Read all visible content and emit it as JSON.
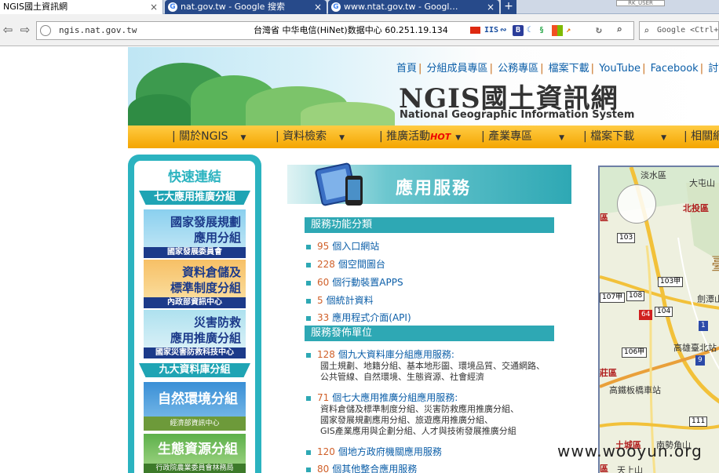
{
  "browser": {
    "tabs": [
      {
        "title": "NGIS國土資訊網",
        "close": "×"
      },
      {
        "title": "nat.gov.tw - Google 搜索",
        "close": "×"
      },
      {
        "title": "www.ntat.gov.tw - Googl…",
        "close": "×"
      }
    ],
    "new_tab": "+",
    "top_right_box": "RK_USER",
    "url": "ngis.nat.gov.tw",
    "isp_info": "台灣省 中华电信(HiNet)数据中心  60.251.19.134",
    "ext_iis": "IIS",
    "ext_b": "B",
    "search_placeholder": "Google <Ctrl+K>"
  },
  "header": {
    "toplinks": [
      "首頁",
      "分組成員專區",
      "公務專區",
      "檔案下載",
      "YouTube",
      "Facebook",
      "討論區"
    ],
    "logo_main": "NGIS國土資訊網",
    "logo_sub": "National Geographic Information System"
  },
  "menu": {
    "items": [
      "關於NGIS",
      "資料檢索",
      "推廣活動",
      "產業專區",
      "檔案下載",
      "相關網"
    ],
    "hot": "HOT"
  },
  "sidebar": {
    "title": "快速連結",
    "group1": "七大應用推廣分組",
    "banners1": [
      {
        "title1": "國家發展規劃",
        "title2": "應用分組",
        "unit": "國家發展委員會"
      },
      {
        "title1": "資料倉儲及",
        "title2": "標準制度分組",
        "unit": "內政部資訊中心"
      },
      {
        "title1": "災害防救",
        "title2": "應用推廣分組",
        "unit": "國家災害防救科技中心"
      }
    ],
    "group2": "九大資料庫分組",
    "banners2": [
      {
        "title": "自然環境分組",
        "unit": "經濟部資訊中心"
      },
      {
        "title": "生態資源分組",
        "unit": "行政院農業委員會林務局"
      }
    ]
  },
  "app_service": {
    "title": "應用服務",
    "section1": "服務功能分類",
    "items1": [
      {
        "num": "95",
        "label": "個入口網站"
      },
      {
        "num": "228",
        "label": "個空間圖台"
      },
      {
        "num": "60",
        "label": "個行動裝置APPS"
      },
      {
        "num": "5",
        "label": "個統計資料"
      },
      {
        "num": "33",
        "label": "應用程式介面(API)"
      }
    ],
    "section2": "服務發佈單位",
    "items2": [
      {
        "num": "128",
        "label": "個九大資料庫分組應用服務:",
        "desc": [
          "國土規劃、地籍分組、基本地形圖、環境品質、交通網路、",
          "公共管線、自然環境、生態資源、社會經濟"
        ]
      },
      {
        "num": "71",
        "label": "個七大應用推廣分組應用服務:",
        "desc": [
          "資料倉儲及標準制度分組、災害防救應用推廣分組、",
          "國家發展規劃應用分組、旅遊應用推廣分組、",
          "GIS產業應用與企劃分組、人才與技術發展推廣分組"
        ]
      },
      {
        "num": "120",
        "label": "個地方政府機關應用服務",
        "desc": []
      },
      {
        "num": "80",
        "label": "個其他整合應用服務",
        "desc": []
      }
    ]
  },
  "map": {
    "labels": [
      "淡水區",
      "大屯山",
      "北投區",
      "區",
      "臺",
      "103",
      "103甲",
      "107甲",
      "108",
      "104",
      "64",
      "劍潭山",
      "1",
      "高雄臺北站",
      "106甲",
      "9",
      "莊區",
      "高鐵板橋車站",
      "111",
      "土城區",
      "南勢角山",
      "天上山",
      "區"
    ]
  },
  "watermark": "www.wooyun.org"
}
